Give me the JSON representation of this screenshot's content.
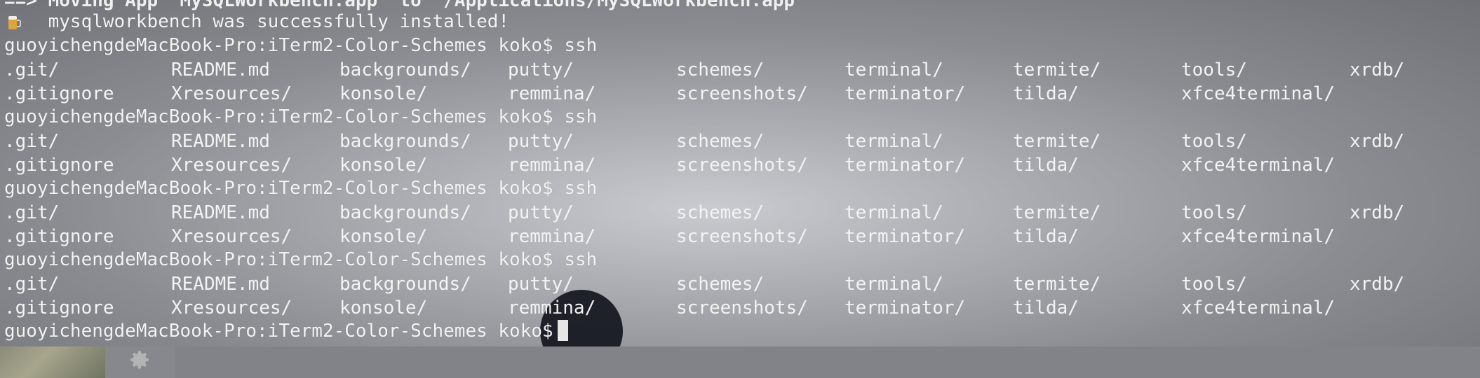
{
  "terminal": {
    "partial_top": "==> Moving App 'MySQLWorkbench.app' to '/Applications/MySQLWorkbench.app'",
    "install_message": "    mysqlworkbench was successfully installed!",
    "prompt": "guoyichengdeMacBook-Pro:iTerm2-Color-Schemes koko$",
    "command": "ssh",
    "listing_row1": [
      ".git/",
      "README.md",
      "backgrounds/",
      "putty/",
      "schemes/",
      "terminal/",
      "termite/",
      "tools/",
      "xrdb/"
    ],
    "listing_row2": [
      ".gitignore",
      "Xresources/",
      "konsole/",
      "remmina/",
      "screenshots/",
      "terminator/",
      "tilda/",
      "xfce4terminal/"
    ]
  },
  "icons": {
    "beer": "beer-icon",
    "gear": "gear-icon"
  },
  "colors": {
    "text": "#f3f3f3",
    "click_indicator": "#14161e"
  }
}
